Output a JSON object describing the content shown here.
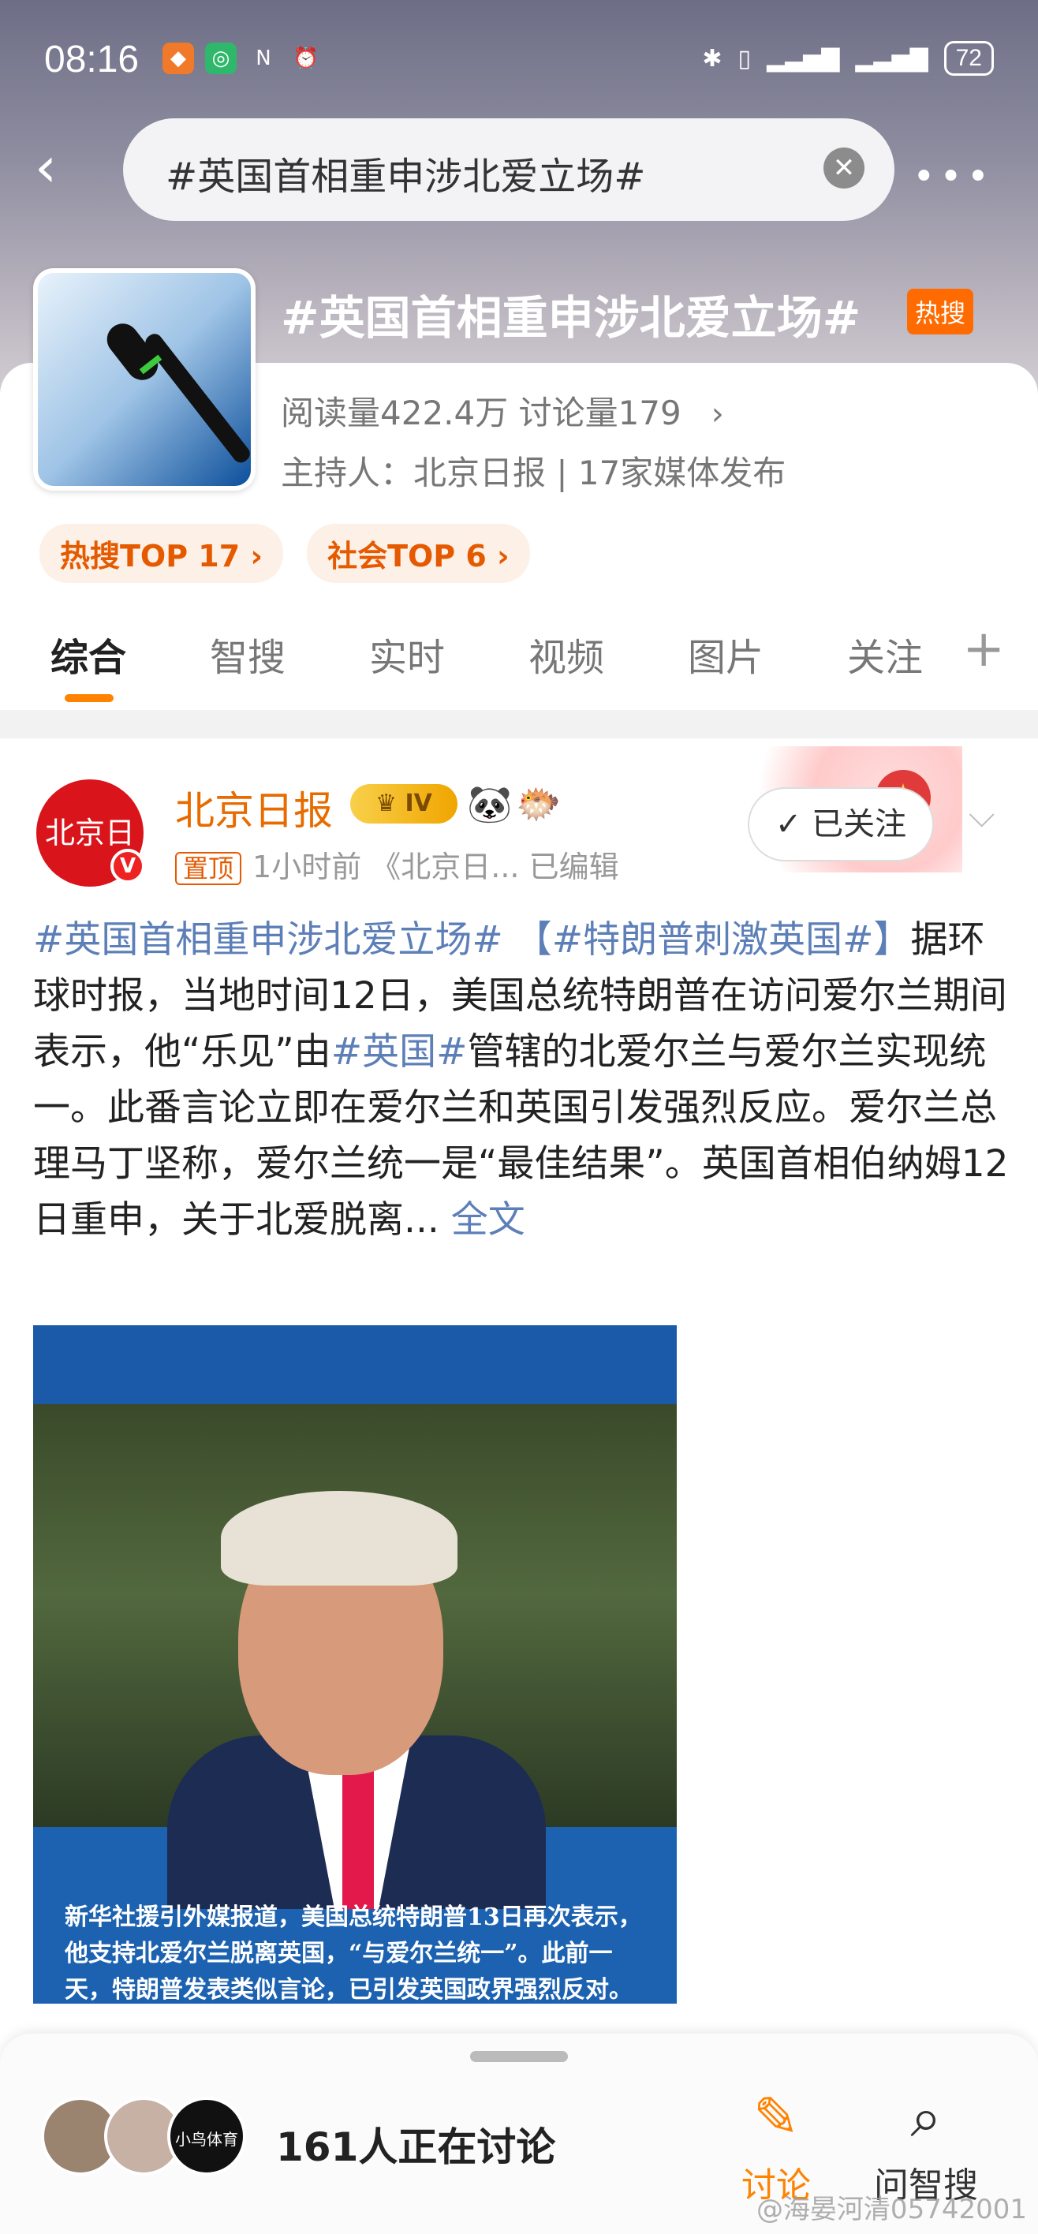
{
  "status_bar": {
    "time": "08:16",
    "battery": "72"
  },
  "search": {
    "query": "#英国首相重申涉北爱立场#"
  },
  "topic": {
    "title": "#英国首相重申涉北爱立场#",
    "badge": "热搜",
    "stats": "阅读量422.4万  讨论量179",
    "host": "主持人：北京日报 | 17家媒体发布",
    "pills": [
      "热搜TOP 17 ›",
      "社会TOP 6 ›"
    ]
  },
  "tabs": {
    "items": [
      "综合",
      "智搜",
      "实时",
      "视频",
      "图片",
      "关注"
    ],
    "active": "综合"
  },
  "post": {
    "author": "北京日报",
    "level": "IV",
    "pinned": "置顶",
    "meta": "1小时前  《北京日...  已编辑",
    "follow_label": "已关注",
    "tag1": "#英国首相重申涉北爱立场#",
    "tag2": "【#特朗普刺激英国#】",
    "text_a": "据环球时报，当地时间12日，美国总统特朗普在访问爱尔兰期间表示，他“乐见”由",
    "tag3": "#英国#",
    "text_b": "管辖的北爱尔兰与爱尔兰实现统一。此番言论立即在爱尔兰和英国引发强烈反应。爱尔兰总理马丁坚称，爱尔兰统一是“最佳结果”。英国首相伯纳姆12日重申，关于北爱脱离...",
    "full_text": "全文",
    "image_caption": "新华社援引外媒报道，美国总统特朗普13日再次表示，他支持北爱尔兰脱离英国，“与爱尔兰统一”。此前一天，特朗普发表类似言论，已引发英国政界强烈反对。"
  },
  "bottom": {
    "discuss_count": "161人正在讨论",
    "discuss_label": "讨论",
    "ask_label": "问智搜",
    "avatar3_text": "小鸟体育",
    "watermark": "@海晏河清05742001"
  },
  "colors": {
    "accent": "#ff8200",
    "link": "#5d7fb8",
    "author": "#e86b00"
  }
}
